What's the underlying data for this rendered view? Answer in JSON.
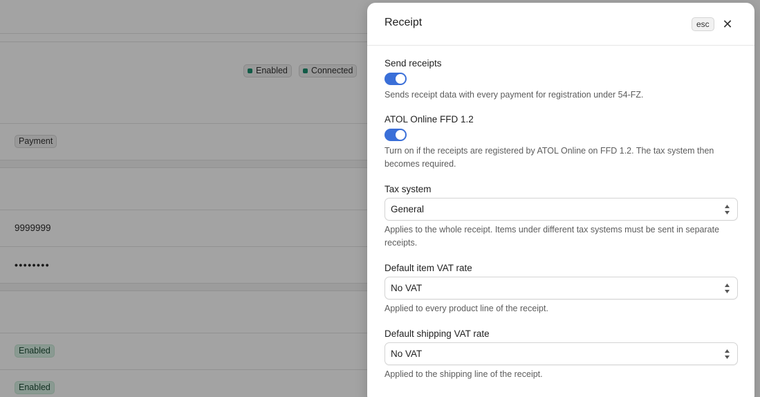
{
  "background": {
    "header_badges": [
      {
        "label": "Enabled",
        "color": "#1d8f6f"
      },
      {
        "label": "Connected",
        "color": "#1d8f6f"
      }
    ],
    "payment_badge": "Payment",
    "account_value": "9999999",
    "password_value": "••••••••",
    "status_badges": [
      "Enabled",
      "Enabled"
    ]
  },
  "modal": {
    "title": "Receipt",
    "esc_label": "esc",
    "close_icon": "close-icon",
    "send_receipts": {
      "label": "Send receipts",
      "enabled": true,
      "help": "Sends receipt data with every payment for registration under 54-FZ."
    },
    "atol": {
      "label": "ATOL Online FFD 1.2",
      "enabled": true,
      "help": "Turn on if the receipts are registered by ATOL Online on FFD 1.2. The tax system then becomes required."
    },
    "tax_system": {
      "label": "Tax system",
      "value": "General",
      "help": "Applies to the whole receipt. Items under different tax systems must be sent in separate receipts."
    },
    "item_vat": {
      "label": "Default item VAT rate",
      "value": "No VAT",
      "help": "Applied to every product line of the receipt."
    },
    "shipping_vat": {
      "label": "Default shipping VAT rate",
      "value": "No VAT",
      "help": "Applied to the shipping line of the receipt."
    }
  },
  "colors": {
    "accent": "#3a6fd8",
    "status_green": "#1d8f6f",
    "overlay": "rgba(0,0,0,0.36)"
  }
}
